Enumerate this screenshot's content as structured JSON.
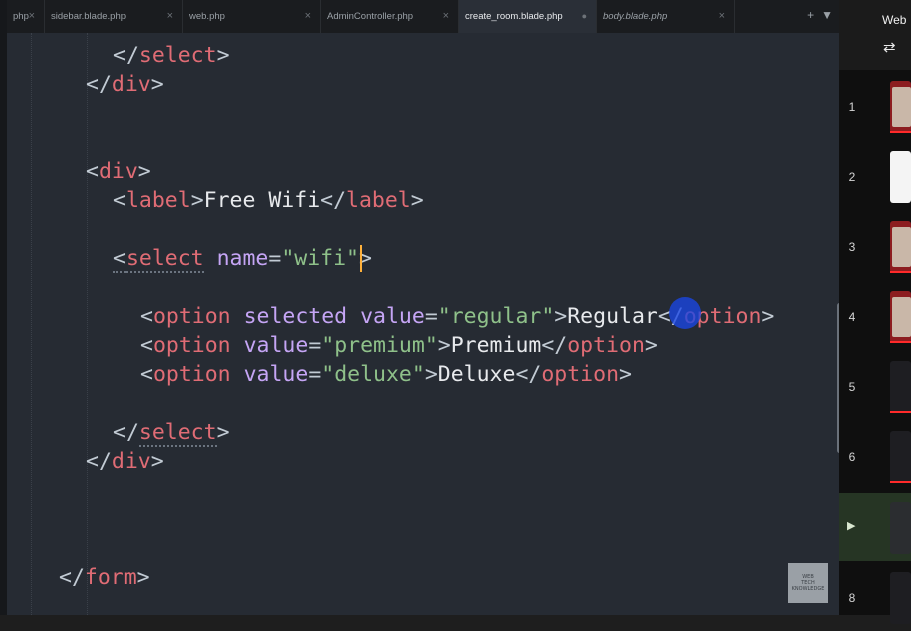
{
  "tabs": [
    {
      "label": "php",
      "active": false,
      "italic": false
    },
    {
      "label": "sidebar.blade.php",
      "active": false,
      "italic": false
    },
    {
      "label": "web.php",
      "active": false,
      "italic": false
    },
    {
      "label": "AdminController.php",
      "active": false,
      "italic": false
    },
    {
      "label": "create_room.blade.php",
      "active": true,
      "italic": false
    },
    {
      "label": "body.blade.php",
      "active": false,
      "italic": true
    }
  ],
  "tab_close_glyph": "×",
  "tab_modified_glyph": "●",
  "tab_actions": {
    "add": "+",
    "menu": "▼"
  },
  "code": {
    "l1": {
      "p1": "</",
      "t": "select",
      "p2": ">"
    },
    "l2": {
      "p1": "</",
      "t": "div",
      "p2": ">"
    },
    "l3": {
      "p1": "<",
      "t": "div",
      "p2": ">"
    },
    "l4": {
      "p1": "<",
      "t": "label",
      "p2": ">",
      "text": "Free Wifi",
      "p3": "</",
      "t2": "label",
      "p4": ">"
    },
    "l5": {
      "p1": "<",
      "t": "select",
      "sp": " ",
      "a": "name",
      "eq": "=",
      "s": "\"wifi",
      "s2": "\"",
      "p2": ">"
    },
    "l6": {
      "p1": "<",
      "t": "option",
      "sp": " ",
      "a1": "selected",
      "sp2": " ",
      "a2": "value",
      "eq": "=",
      "s": "\"regular\"",
      "p2": ">",
      "text": "Regular",
      "p3": "</",
      "t2": "option",
      "p4": ">"
    },
    "l7": {
      "p1": "<",
      "t": "option",
      "sp": " ",
      "a": "value",
      "eq": "=",
      "s": "\"premium\"",
      "p2": ">",
      "text": "Premium",
      "p3": "</",
      "t2": "option",
      "p4": ">"
    },
    "l8": {
      "p1": "<",
      "t": "option",
      "sp": " ",
      "a": "value",
      "eq": "=",
      "s": "\"deluxe\"",
      "p2": ">",
      "text": "Deluxe",
      "p3": "</",
      "t2": "option",
      "p4": ">"
    },
    "l9": {
      "p1": "</",
      "t": "select",
      "p2": ">"
    },
    "l10": {
      "p1": "</",
      "t": "div",
      "p2": ">"
    },
    "l11": {
      "p1": "</",
      "t": "form",
      "p2": ">"
    }
  },
  "watermark": {
    "l1": "WEB",
    "l2": "TECH",
    "l3": "KNOWLEDGE"
  },
  "right_panel": {
    "title": "Web",
    "loop_icon": "⇄",
    "playlist": [
      {
        "num": "1",
        "thumb": "red"
      },
      {
        "num": "2",
        "thumb": "white"
      },
      {
        "num": "3",
        "thumb": "red"
      },
      {
        "num": "4",
        "thumb": "red"
      },
      {
        "num": "5",
        "thumb": "dark"
      },
      {
        "num": "6",
        "thumb": "dark"
      },
      {
        "num": "▶",
        "thumb": "dark",
        "current": true
      },
      {
        "num": "8",
        "thumb": "dark"
      }
    ]
  },
  "colors": {
    "editor_bg": "#262b33",
    "tag": "#e06c75",
    "attribute": "#c5a5f5",
    "string": "#8fc18a",
    "text": "#e8eaed",
    "cursor": "#ffb13b",
    "click_indicator": "#1946e6"
  }
}
